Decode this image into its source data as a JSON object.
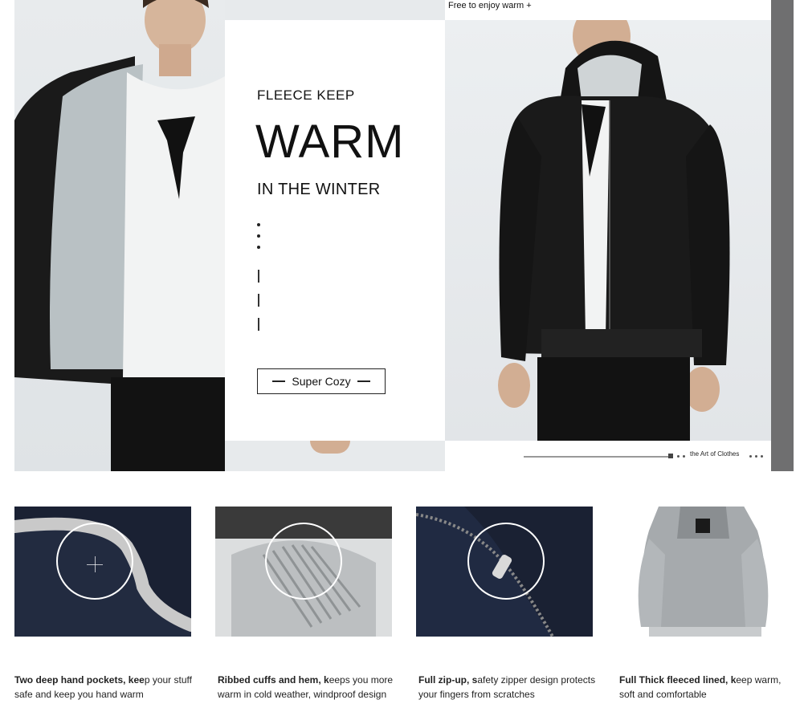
{
  "banner": {
    "top_bar": "Free to enjoy warm +",
    "line1": "FLEECE KEEP",
    "headline": "WARM",
    "line3": "IN THE WINTER",
    "button_label": "Super Cozy",
    "caption": "the Art of Clothes"
  },
  "features": [
    {
      "icon": "hand-pocket",
      "bold": "Two deep hand pockets, kee",
      "rest": "p your stuff safe and keep you hand warm"
    },
    {
      "icon": "ribbed-cuff",
      "bold": "Ribbed cuffs and hem, k",
      "rest": "eeps you more warm in cold weather, windproof design"
    },
    {
      "icon": "zipper",
      "bold": "Full zip-up, s",
      "rest": "afety zipper design protects your fingers from scratches"
    },
    {
      "icon": "fleece-lining",
      "bold": "Full Thick fleeced lined, k",
      "rest": "eep warm, soft and comfortable"
    }
  ],
  "colors": {
    "jacket": "#1a1a1a",
    "fleece": "#b9c1c4",
    "navy": "#1c2336",
    "grey_strip": "#6f6f70"
  }
}
